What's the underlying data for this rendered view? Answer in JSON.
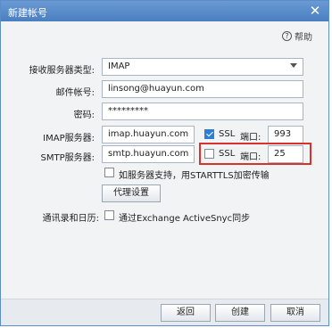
{
  "window": {
    "title": "新建帐号",
    "close_label": "✕"
  },
  "help": {
    "label": "帮助",
    "icon": "question-icon"
  },
  "form": {
    "server_type": {
      "label": "接收服务器类型:",
      "value": "IMAP"
    },
    "email": {
      "label": "邮件帐号:",
      "value": "linsong@huayun.com"
    },
    "password": {
      "label": "密码:",
      "value": "*********"
    },
    "imap": {
      "label": "IMAP服务器:",
      "value": "imap.huayun.com",
      "ssl_label": "SSL",
      "ssl_checked": true,
      "port_label": "端口:",
      "port": "993"
    },
    "smtp": {
      "label": "SMTP服务器:",
      "value": "smtp.huayun.com",
      "ssl_label": "SSL",
      "ssl_checked": false,
      "port_label": "端口:",
      "port": "25"
    },
    "starttls": {
      "label": "如服务器支持，用STARTTLS加密传输",
      "checked": false
    },
    "proxy_button": "代理设置",
    "sync": {
      "label": "通讯录和日历:",
      "option": "通过Exchange ActiveSnyc同步",
      "checked": false
    }
  },
  "buttons": {
    "back": "返回",
    "create": "创建",
    "cancel": "取消"
  },
  "colors": {
    "titlebar": "#4a7fc0",
    "highlight": "#d9322d",
    "checkbox_checked": "#2d7fd3"
  }
}
